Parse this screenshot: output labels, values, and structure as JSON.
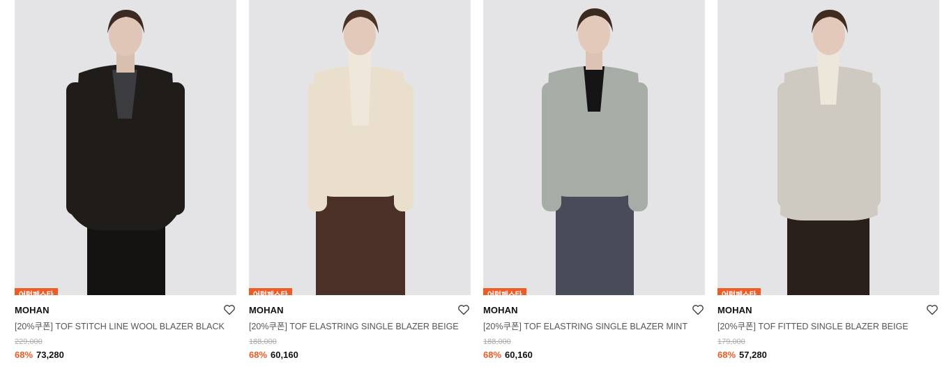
{
  "products": [
    {
      "badge": "어텀페스타",
      "brand": "MOHAN",
      "name": "[20%쿠폰] TOF STITCH LINE WOOL BLAZER BLACK",
      "original_price": "229,000",
      "discount": "68%",
      "price": "73,280",
      "jacket_color": "#1f1c1a",
      "pants_color": "#151312",
      "inner_color": "#3c3b40"
    },
    {
      "badge": "어텀페스타",
      "brand": "MOHAN",
      "name": "[20%쿠폰] TOF ELASTRING SINGLE BLAZER BEIGE",
      "original_price": "188,000",
      "discount": "68%",
      "price": "60,160",
      "jacket_color": "#e9dfcc",
      "pants_color": "#4a3026",
      "inner_color": "#efe8da"
    },
    {
      "badge": "어텀페스타",
      "brand": "MOHAN",
      "name": "[20%쿠폰] TOF ELASTRING SINGLE BLAZER MINT",
      "original_price": "188,000",
      "discount": "68%",
      "price": "60,160",
      "jacket_color": "#a6ada6",
      "pants_color": "#4a4b58",
      "inner_color": "#141414"
    },
    {
      "badge": "어텀페스타",
      "brand": "MOHAN",
      "name": "[20%쿠폰] TOF FITTED SINGLE BLAZER BEIGE",
      "original_price": "179,000",
      "discount": "68%",
      "price": "57,280",
      "jacket_color": "#cfcac1",
      "pants_color": "#2a201b",
      "inner_color": "#ece6db"
    }
  ],
  "colors": {
    "accent": "#f05a24",
    "photo_background": "#e4e3e6"
  },
  "icons": {
    "wishlist": "heart-icon"
  }
}
